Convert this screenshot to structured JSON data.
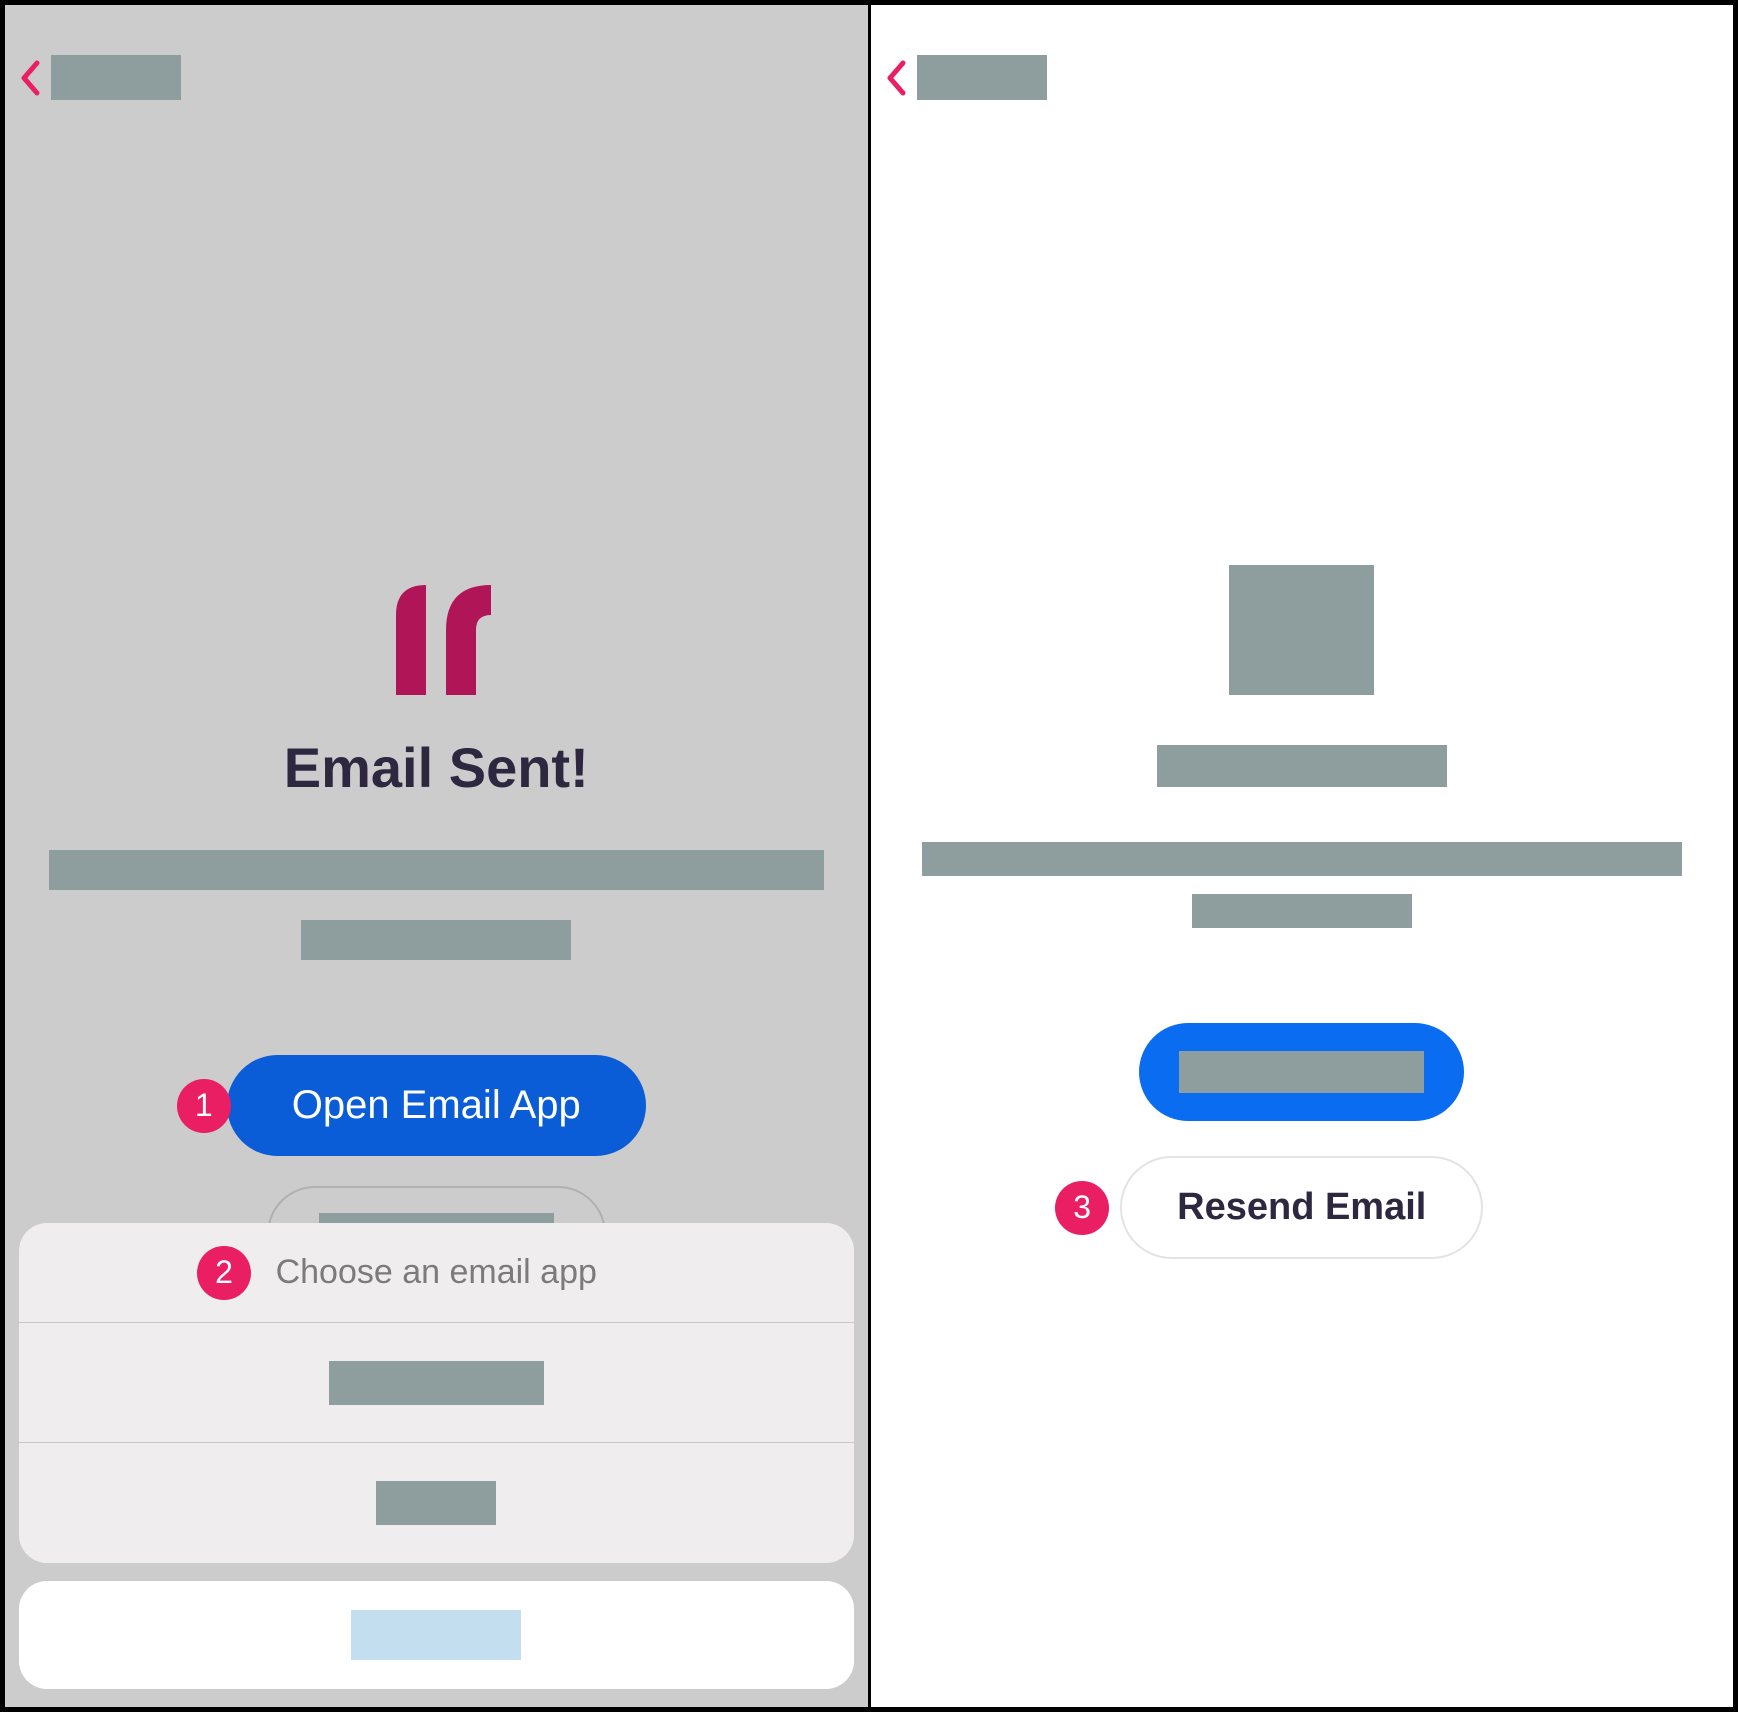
{
  "left": {
    "title": "Email Sent!",
    "open_email_label": "Open Email App",
    "sheet_title": "Choose an email app"
  },
  "right": {
    "resend_label": "Resend Email"
  },
  "callouts": {
    "one": "1",
    "two": "2",
    "three": "3"
  },
  "colors": {
    "accent_pink": "#e91e63",
    "button_blue": "#0a5cd7",
    "logo_magenta": "#b01657"
  }
}
